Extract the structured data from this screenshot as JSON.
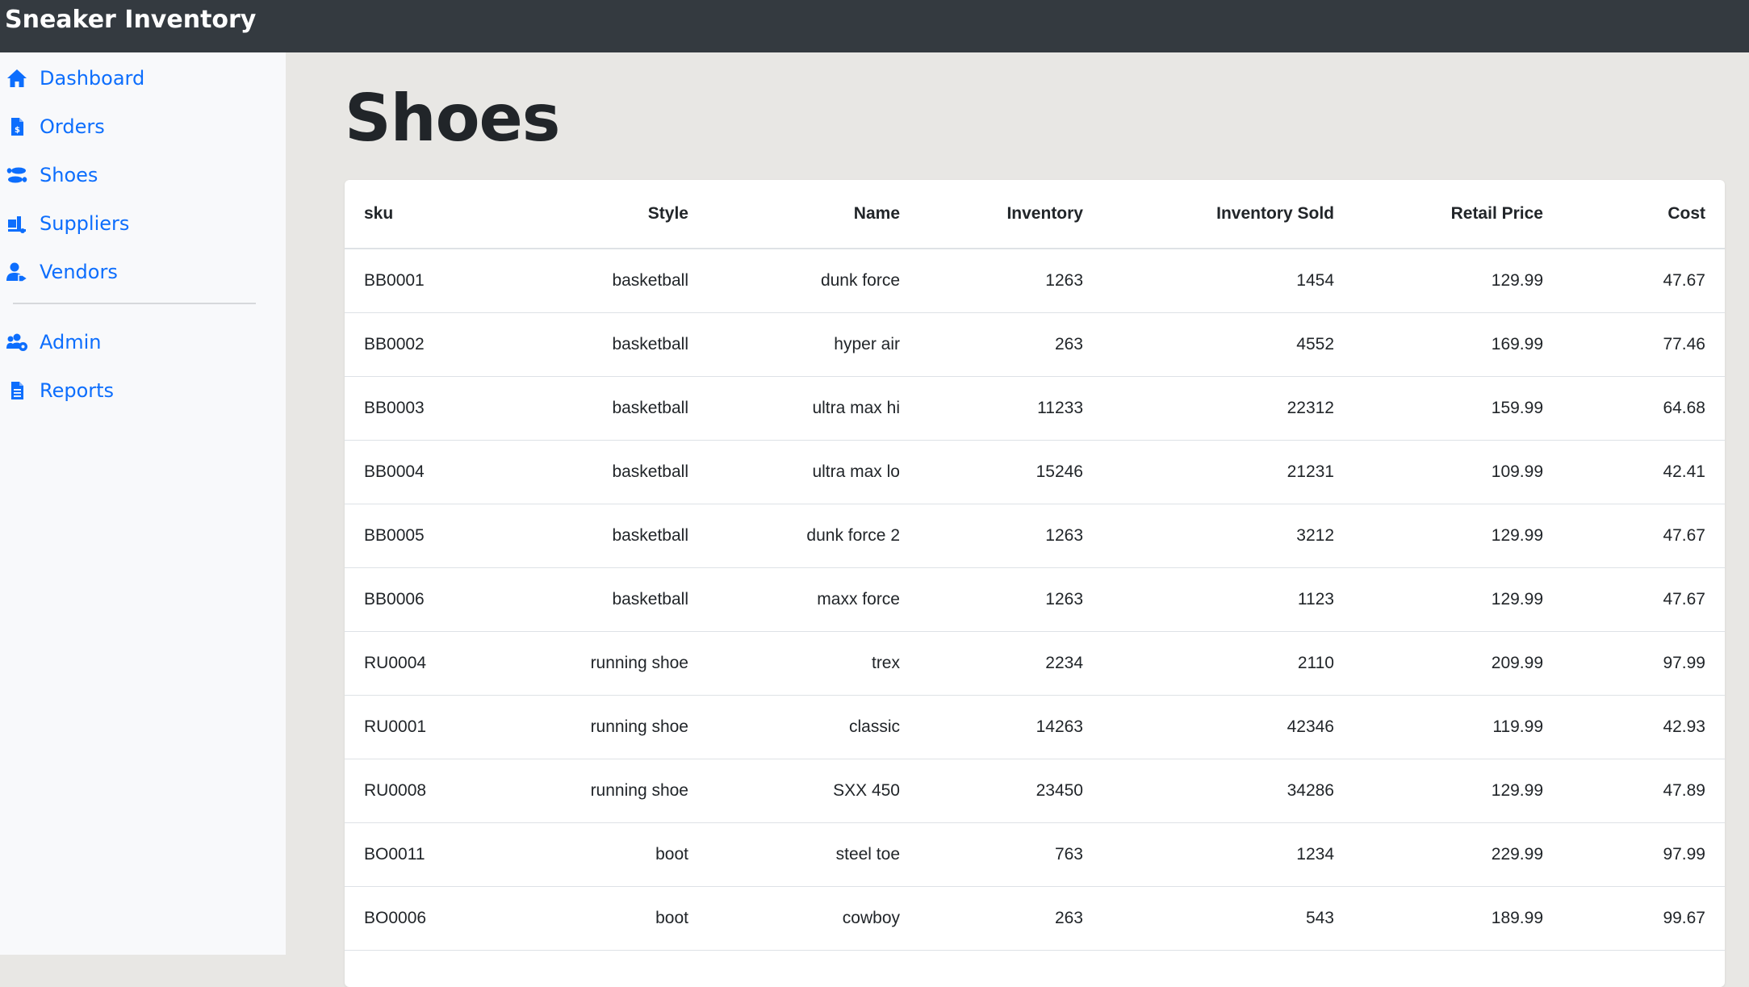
{
  "app": {
    "brand": "Sneaker Inventory"
  },
  "sidebar": {
    "items": [
      {
        "label": "Dashboard",
        "icon": "home-icon"
      },
      {
        "label": "Orders",
        "icon": "invoice-icon"
      },
      {
        "label": "Shoes",
        "icon": "shoe-prints-icon"
      },
      {
        "label": "Suppliers",
        "icon": "truck-loading-icon"
      },
      {
        "label": "Vendors",
        "icon": "user-tag-icon"
      },
      {
        "label": "Admin",
        "icon": "users-cog-icon"
      },
      {
        "label": "Reports",
        "icon": "file-alt-icon"
      }
    ]
  },
  "main": {
    "title": "Shoes"
  },
  "table": {
    "headers": [
      "sku",
      "Style",
      "Name",
      "Inventory",
      "Inventory Sold",
      "Retail Price",
      "Cost"
    ],
    "rows": [
      [
        "BB0001",
        "basketball",
        "dunk force",
        "1263",
        "1454",
        "129.99",
        "47.67"
      ],
      [
        "BB0002",
        "basketball",
        "hyper air",
        "263",
        "4552",
        "169.99",
        "77.46"
      ],
      [
        "BB0003",
        "basketball",
        "ultra max hi",
        "11233",
        "22312",
        "159.99",
        "64.68"
      ],
      [
        "BB0004",
        "basketball",
        "ultra max lo",
        "15246",
        "21231",
        "109.99",
        "42.41"
      ],
      [
        "BB0005",
        "basketball",
        "dunk force 2",
        "1263",
        "3212",
        "129.99",
        "47.67"
      ],
      [
        "BB0006",
        "basketball",
        "maxx force",
        "1263",
        "1123",
        "129.99",
        "47.67"
      ],
      [
        "RU0004",
        "running shoe",
        "trex",
        "2234",
        "2110",
        "209.99",
        "97.99"
      ],
      [
        "RU0001",
        "running shoe",
        "classic",
        "14263",
        "42346",
        "119.99",
        "42.93"
      ],
      [
        "RU0008",
        "running shoe",
        "SXX 450",
        "23450",
        "34286",
        "129.99",
        "47.89"
      ],
      [
        "BO0011",
        "boot",
        "steel toe",
        "763",
        "1234",
        "229.99",
        "97.99"
      ],
      [
        "BO0006",
        "boot",
        "cowboy",
        "263",
        "543",
        "189.99",
        "99.67"
      ]
    ]
  },
  "colors": {
    "accent": "#0d6efd",
    "topbar": "#343a40",
    "sidebar": "#f8f9fb",
    "main_background": "#e8e7e4"
  }
}
